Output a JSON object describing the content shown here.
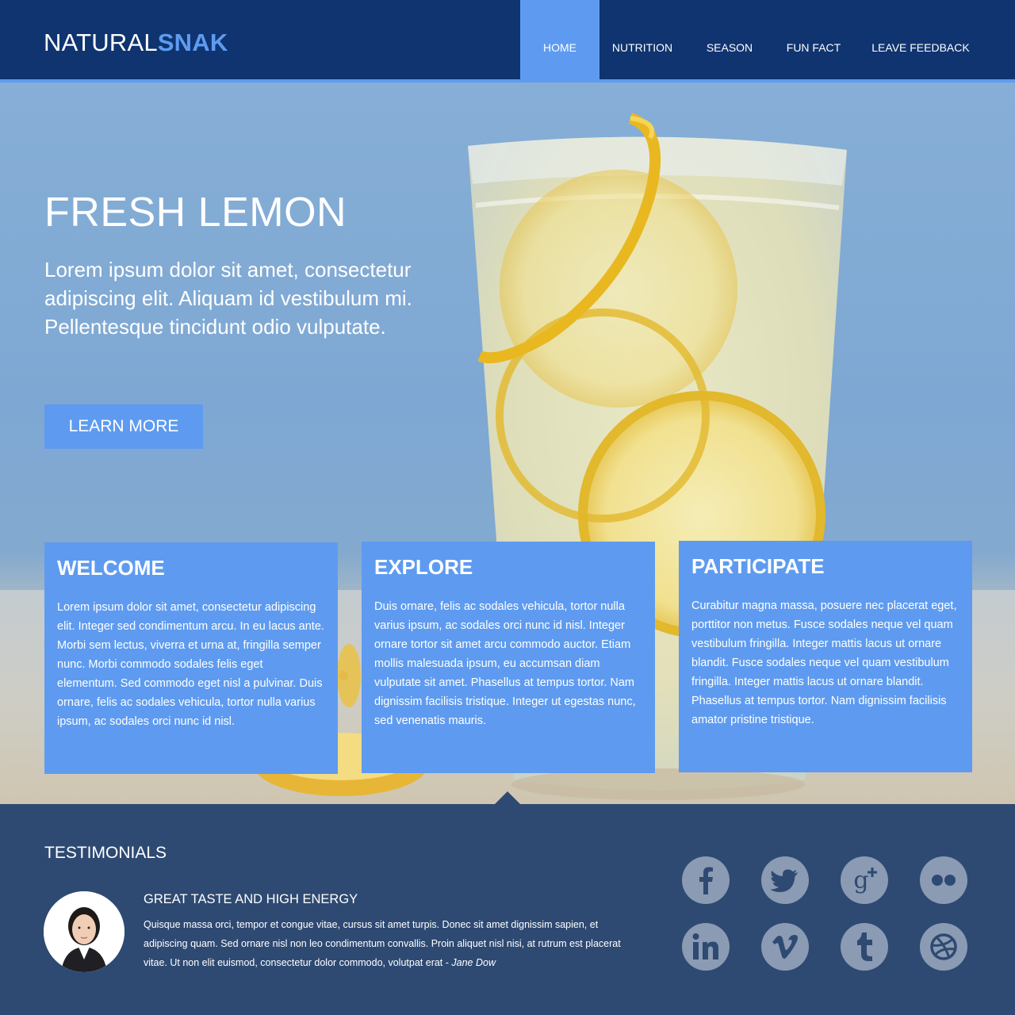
{
  "brand": {
    "part1": "NATURAL",
    "part2": "SNAK"
  },
  "nav": [
    {
      "label": "HOME",
      "active": true
    },
    {
      "label": "NUTRITION",
      "active": false
    },
    {
      "label": "SEASON",
      "active": false
    },
    {
      "label": "FUN FACT",
      "active": false
    },
    {
      "label": "LEAVE FEEDBACK",
      "active": false
    }
  ],
  "hero": {
    "title": "FRESH LEMON",
    "text": "Lorem ipsum dolor sit amet, consectetur adipiscing elit. Aliquam id vestibulum mi. Pellentesque tincidunt odio vulputate.",
    "button": "LEARN MORE"
  },
  "cards": [
    {
      "title": "WELCOME",
      "body": "Lorem ipsum dolor sit amet, consectetur adipiscing elit. Integer sed condimentum arcu. In eu lacus ante. Morbi sem lectus, viverra et urna at, fringilla semper nunc. Morbi commodo sodales felis eget elementum. Sed commodo eget nisl a pulvinar. Duis ornare, felis ac sodales vehicula, tortor nulla varius ipsum, ac sodales orci nunc id nisl."
    },
    {
      "title": "EXPLORE",
      "body": "Duis ornare, felis ac sodales vehicula, tortor nulla varius ipsum, ac sodales orci nunc id nisl. Integer ornare tortor sit amet arcu commodo auctor. Etiam mollis malesuada ipsum, eu accumsan diam vulputate sit amet. Phasellus at tempus tortor. Nam dignissim facilisis tristique. Integer ut egestas nunc, sed venenatis mauris."
    },
    {
      "title": "PARTICIPATE",
      "body": "Curabitur magna massa, posuere nec placerat eget, porttitor non metus. Fusce sodales neque vel quam vestibulum fringilla. Integer mattis lacus ut ornare blandit. Fusce sodales neque vel quam vestibulum fringilla. Integer mattis lacus ut ornare blandit. Phasellus at tempus tortor. Nam dignissim facilisis amator pristine tristique."
    }
  ],
  "testimonials": {
    "heading": "TESTIMONIALS",
    "title": "GREAT TASTE AND HIGH ENERGY",
    "quote": "Quisque massa orci, tempor et congue vitae, cursus sit amet turpis. Donec sit amet dignissim sapien, et adipiscing quam. Sed ornare nisl non leo condimentum convallis. Proin aliquet nisl nisi, at rutrum est placerat vitae. Ut non elit euismod, consectetur dolor commodo, volutpat erat - ",
    "author": "Jane Dow"
  },
  "social": [
    "facebook-icon",
    "twitter-icon",
    "google-plus-icon",
    "flickr-icon",
    "linkedin-icon",
    "vimeo-icon",
    "tumblr-icon",
    "dribbble-icon"
  ],
  "colors": {
    "header": "#0f3470",
    "accent": "#5e9bf0",
    "footer": "#2e4a72",
    "social": "#8a9bb3"
  }
}
